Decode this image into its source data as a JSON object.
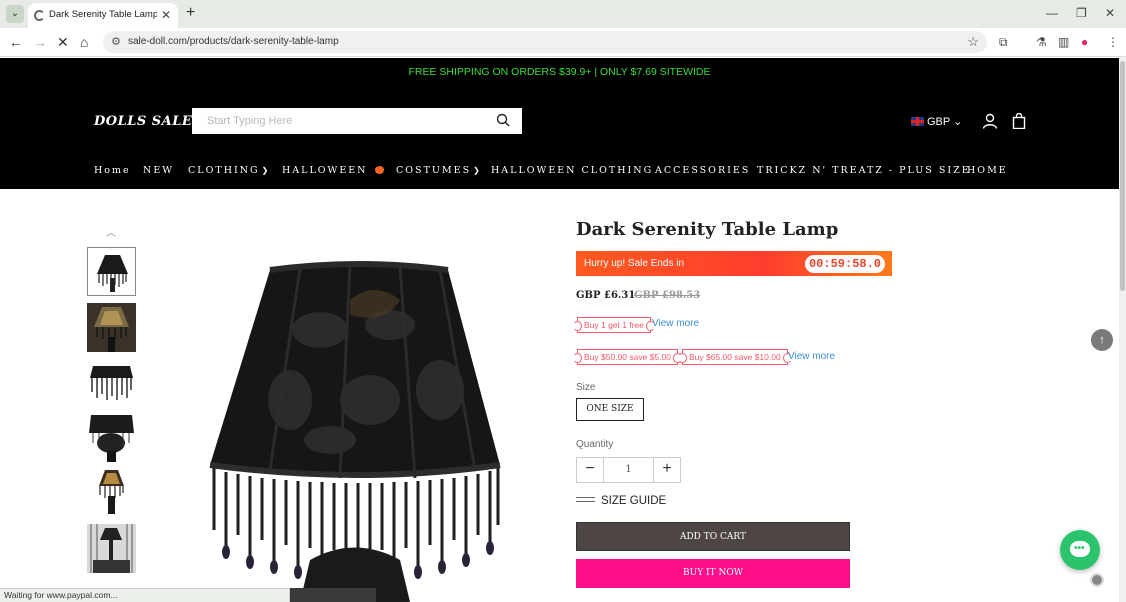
{
  "browser": {
    "tab_title": "Dark Serenity Table Lamp - sa",
    "url": "sale-doll.com/products/dark-serenity-table-lamp",
    "status_text": "Waiting for www.paypal.com..."
  },
  "site": {
    "promo_bar": "FREE SHIPPING ON ORDERS $39.9+ | ONLY $7.69 SITEWIDE",
    "logo": "DOLLS SALE",
    "search_placeholder": "Start Typing Here",
    "currency": "GBP",
    "nav": [
      {
        "label": "Home"
      },
      {
        "label": "NEW"
      },
      {
        "label": "CLOTHING",
        "dropdown": true
      },
      {
        "label": "HALLOWEEN",
        "badge": "pumpkin"
      },
      {
        "label": "COSTUMES",
        "dropdown": true
      },
      {
        "label": "HALLOWEEN CLOTHING"
      },
      {
        "label": "ACCESSORIES"
      },
      {
        "label": "TRICKZ N' TREATZ - PLUS SIZE"
      },
      {
        "label": "HOME"
      }
    ]
  },
  "product": {
    "title": "Dark Serenity Table Lamp",
    "sale_banner_text": "Hurry up! Sale Ends in",
    "countdown": "00:59:58.0",
    "price": "GBP £6.31",
    "old_price": "GBP £98.53",
    "offers_row1": [
      "Buy 1 get 1 free"
    ],
    "offers_row2": [
      "Buy $50.00 save $5.00",
      "Buy $65.00 save $10.00"
    ],
    "view_more": "View more",
    "size_label": "Size",
    "size_option": "ONE SIZE",
    "quantity_label": "Quantity",
    "quantity": "1",
    "size_guide": "SIZE GUIDE",
    "add_to_cart": "ADD TO CART",
    "buy_now": "BUY IT NOW"
  },
  "colors": {
    "promo_text": "#3ddc3d",
    "buy_now": "#ff0d8a",
    "add_to_cart": "#4d4644",
    "countdown": "#e8462a",
    "coupon": "#f25a6b",
    "link": "#3a8fd6",
    "chat": "#2bc36b"
  }
}
